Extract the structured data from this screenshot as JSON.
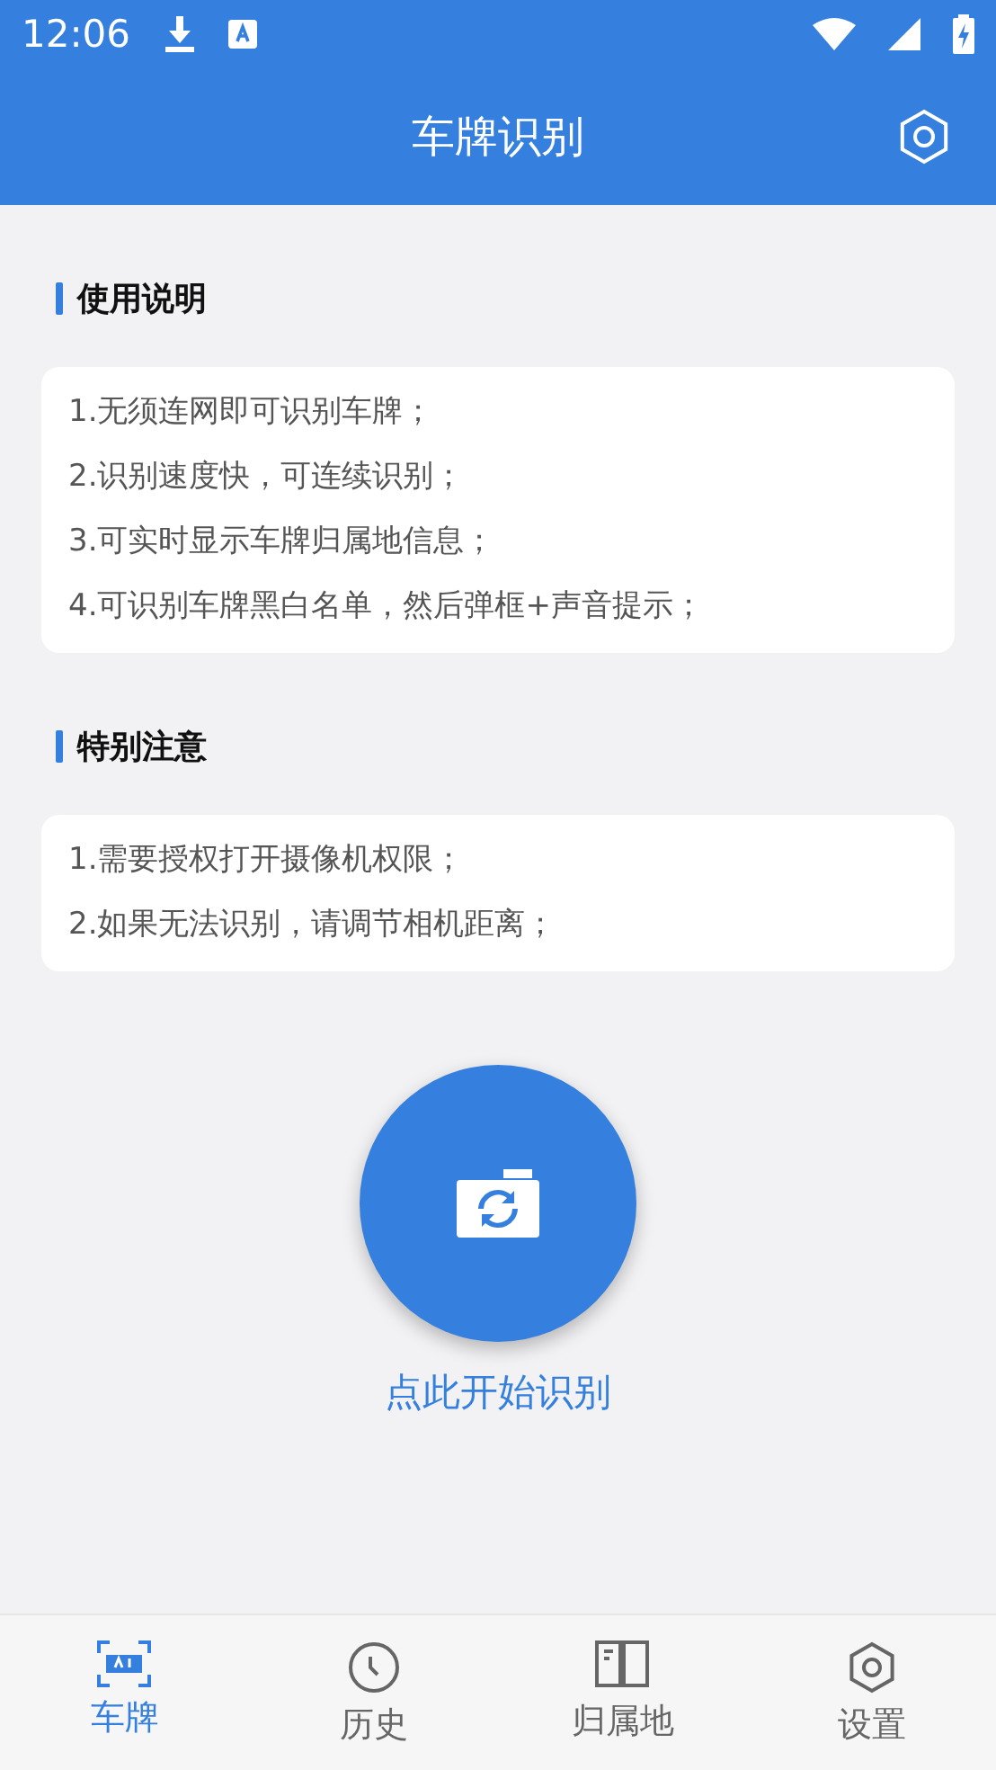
{
  "status_bar": {
    "time": "12:06"
  },
  "header": {
    "title": "车牌识别"
  },
  "sections": [
    {
      "title": "使用说明",
      "lines": [
        "1.无须连网即可识别车牌；",
        "2.识别速度快，可连续识别；",
        "3.可实时显示车牌归属地信息；",
        "4.可识别车牌黑白名单，然后弹框+声音提示；"
      ]
    },
    {
      "title": "特别注意",
      "lines": [
        "1.需要授权打开摄像机权限；",
        "2.如果无法识别，请调节相机距离；"
      ]
    }
  ],
  "start": {
    "label": "点此开始识别"
  },
  "tabs": [
    {
      "kind": "plate",
      "label": "车牌",
      "selected": true
    },
    {
      "kind": "history",
      "label": "历史",
      "selected": false
    },
    {
      "kind": "book",
      "label": "归属地",
      "selected": false
    },
    {
      "kind": "settings",
      "label": "设置",
      "selected": false
    }
  ]
}
